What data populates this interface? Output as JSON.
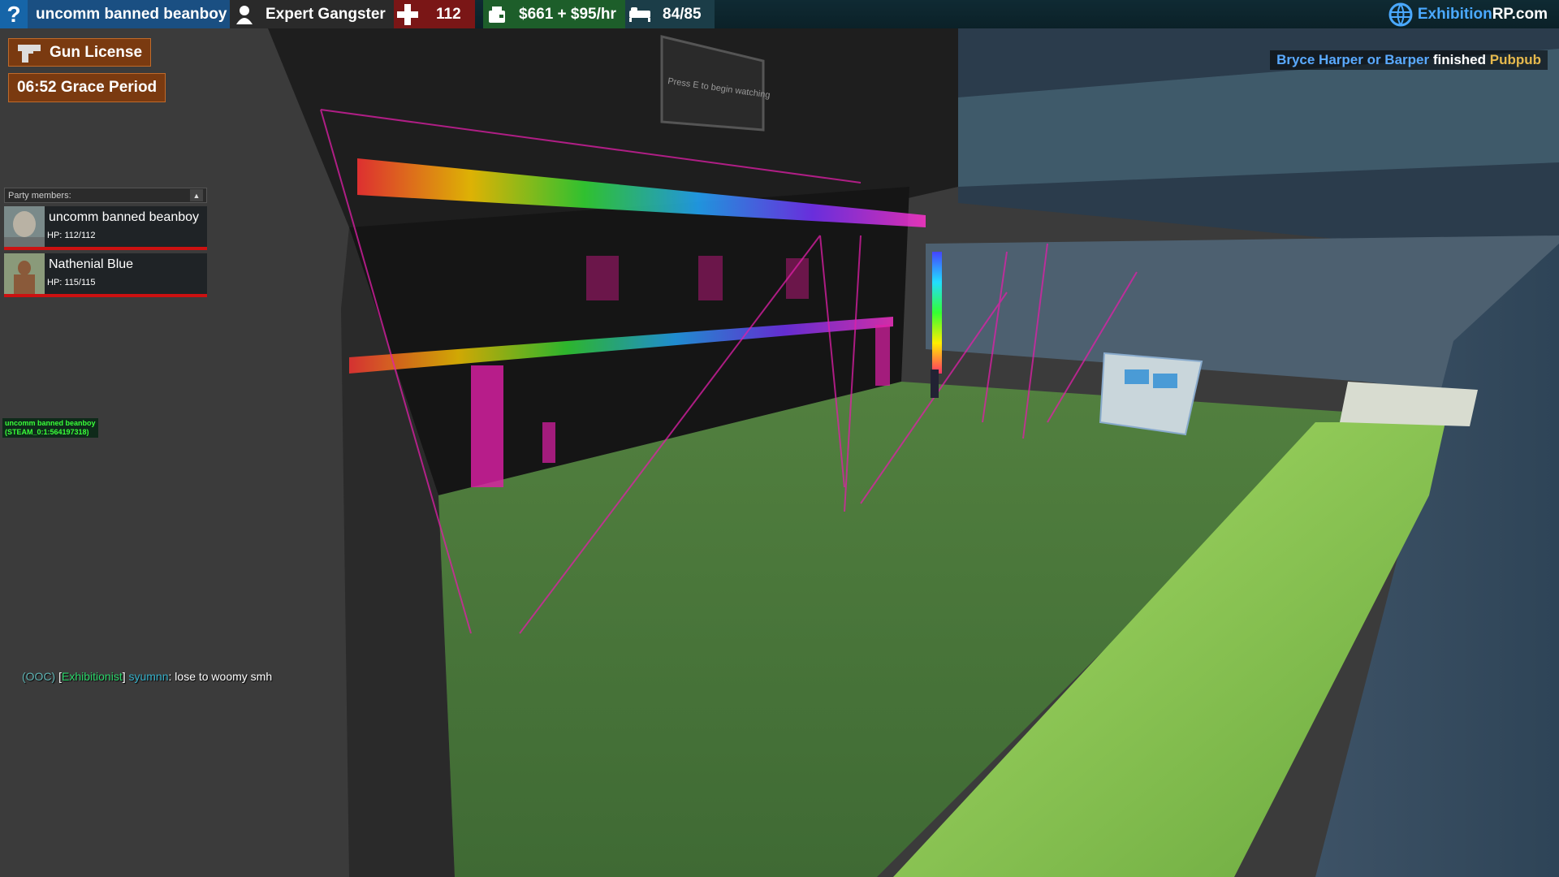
{
  "hud": {
    "player_name": "uncomm banned beanboy",
    "job": "Expert Gangster",
    "health": "112",
    "money": "$661 + $95/hr",
    "armor": "84/85",
    "brand_blue": "Exhibition",
    "brand_white": "RP.com",
    "help_icon": "question-icon",
    "job_icon": "person-icon",
    "health_icon": "plus-icon",
    "money_icon": "wallet-icon",
    "armor_icon": "bed-icon",
    "brand_icon": "globe-icon"
  },
  "badges": {
    "license": "Gun License",
    "license_icon": "pistol-icon",
    "grace": "06:52 Grace Period"
  },
  "party": {
    "header": "Party members:",
    "toggle": "▲",
    "members": [
      {
        "name": "uncomm banned beanboy",
        "hp": "HP: 112/112"
      },
      {
        "name": "Nathenial Blue",
        "hp": "HP: 115/115"
      }
    ]
  },
  "player_tag": {
    "name": "uncomm banned beanboy",
    "steam_id": "(STEAM_0:1:564197318)"
  },
  "killfeed": {
    "actor": "Bryce Harper or Barper",
    "verb": "finished",
    "target": "Pubpub"
  },
  "chat": {
    "channel": "(OOC)",
    "bracket_open": "[",
    "rank": "Exhibitionist",
    "bracket_close": "]",
    "player": "syumnn",
    "message": ": lose to woomy smh"
  },
  "world": {
    "screen_text": "Press E to begin watching"
  },
  "colors": {
    "health_red": "#7a1616",
    "money_green": "#1d5e2a",
    "party_hp_bar": "#cc1111",
    "brand_blue": "#4aa9ff",
    "killfeed_actor": "#5aaaff",
    "killfeed_target": "#e6b94d"
  }
}
